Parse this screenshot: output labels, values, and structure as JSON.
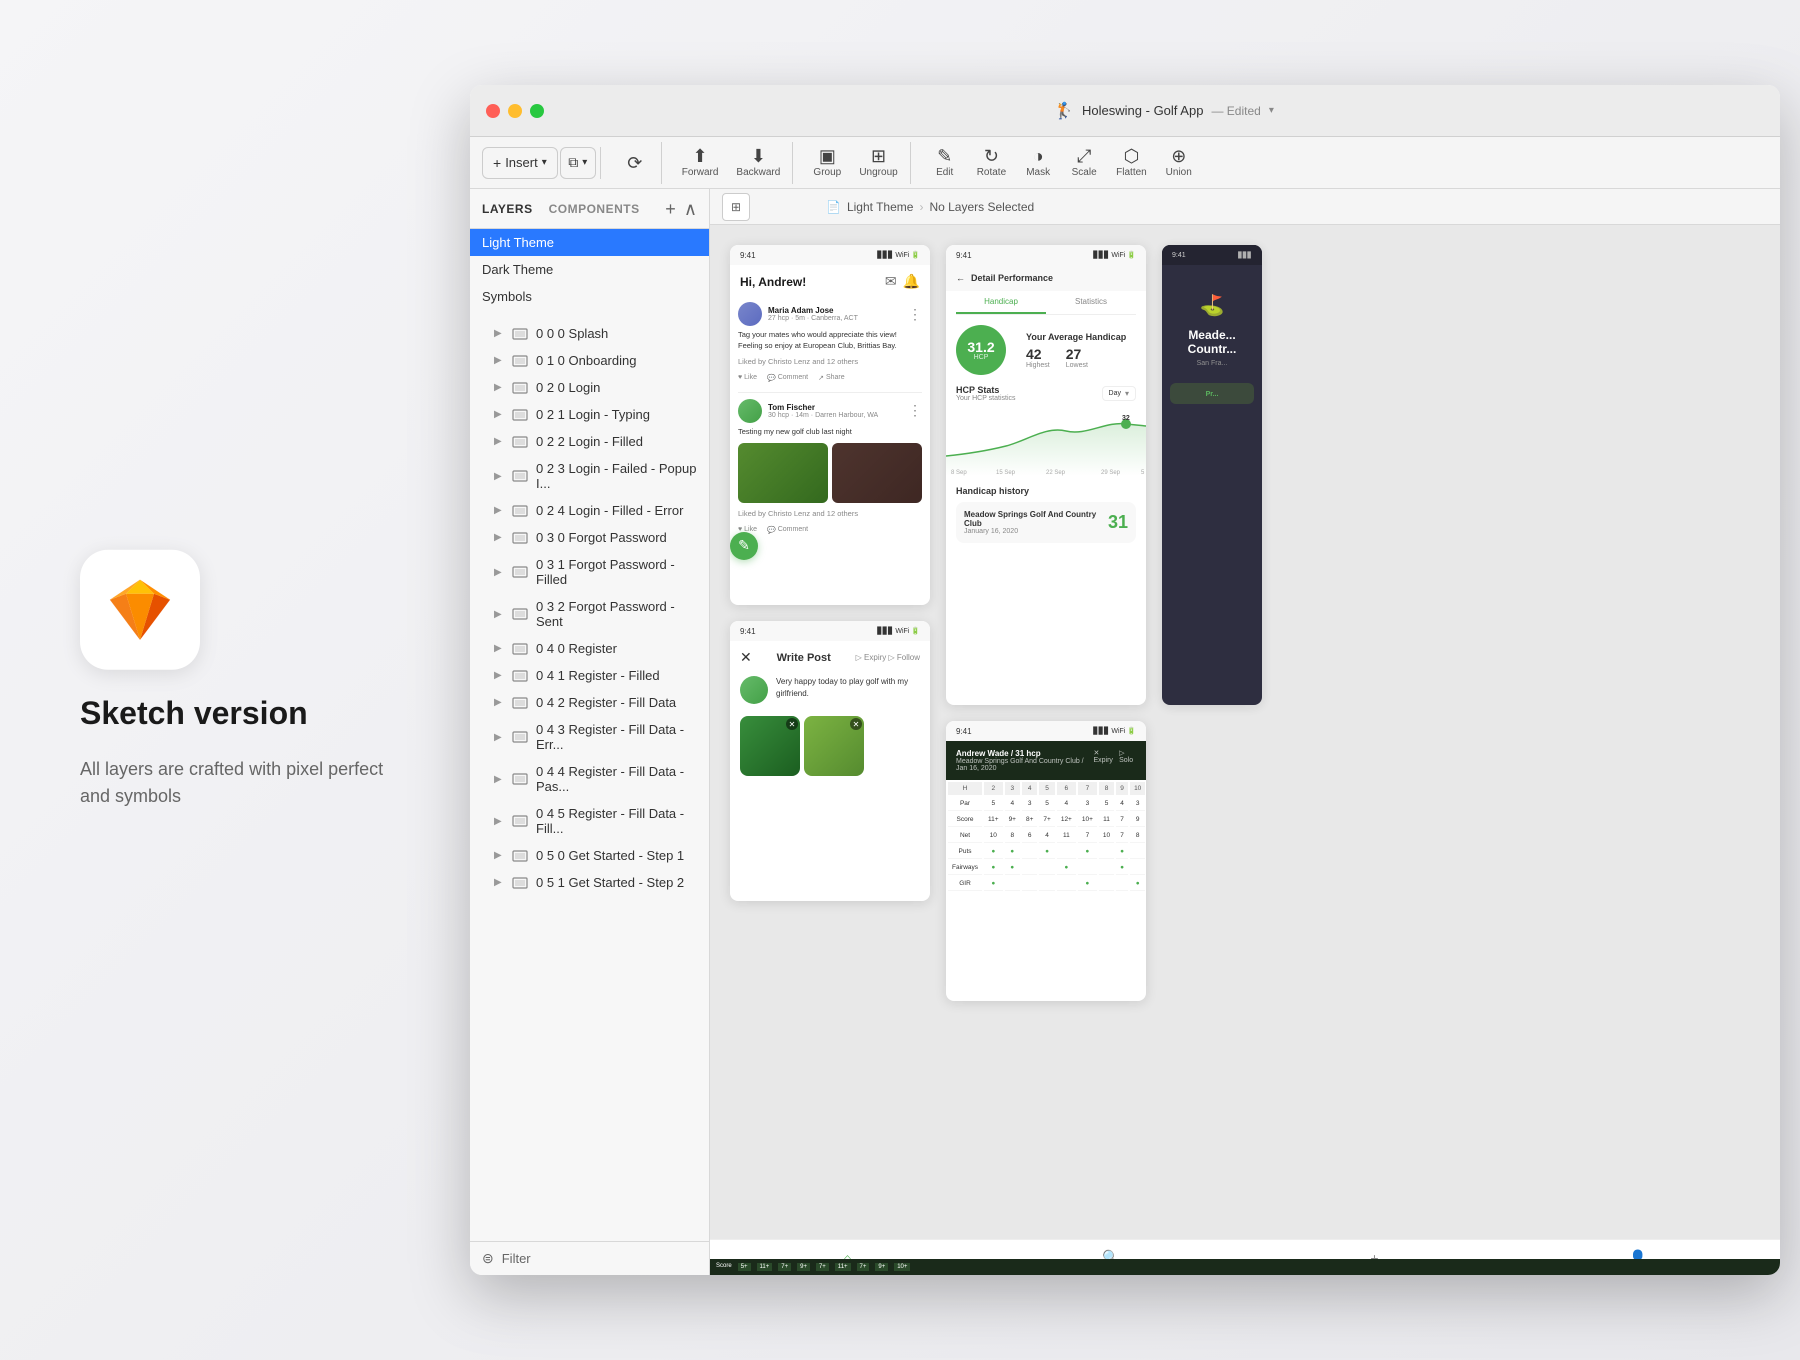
{
  "app": {
    "title": "Holeswing - Golf App",
    "edited": "Edited",
    "logo_icon": "🏌️"
  },
  "window": {
    "traffic_lights": [
      "red",
      "yellow",
      "green"
    ]
  },
  "toolbar": {
    "insert_label": "Insert",
    "data_label": "Data",
    "create_symbol_label": "Create Symbol",
    "forward_label": "Forward",
    "backward_label": "Backward",
    "group_label": "Group",
    "ungroup_label": "Ungroup",
    "edit_label": "Edit",
    "rotate_label": "Rotate",
    "mask_label": "Mask",
    "scale_label": "Scale",
    "flatten_label": "Flatten",
    "union_label": "Union"
  },
  "sidebar": {
    "tabs": [
      {
        "id": "layers",
        "label": "LAYERS"
      },
      {
        "id": "components",
        "label": "COMPONENTS"
      }
    ],
    "pages": [
      {
        "id": "light-theme",
        "label": "Light Theme",
        "active": true
      },
      {
        "id": "dark-theme",
        "label": "Dark Theme"
      },
      {
        "id": "symbols",
        "label": "Symbols"
      }
    ],
    "layers": [
      {
        "id": "000",
        "label": "0 0 0 Splash"
      },
      {
        "id": "010",
        "label": "0 1 0 Onboarding"
      },
      {
        "id": "020",
        "label": "0 2 0 Login"
      },
      {
        "id": "021",
        "label": "0 2 1 Login - Typing"
      },
      {
        "id": "022",
        "label": "0 2 2 Login - Filled"
      },
      {
        "id": "023",
        "label": "0 2 3 Login - Failed - Popup I..."
      },
      {
        "id": "024",
        "label": "0 2 4 Login - Filled - Error"
      },
      {
        "id": "030",
        "label": "0 3 0 Forgot Password"
      },
      {
        "id": "031",
        "label": "0 3 1 Forgot Password - Filled"
      },
      {
        "id": "032",
        "label": "0 3 2 Forgot Password - Sent"
      },
      {
        "id": "040",
        "label": "0 4 0 Register"
      },
      {
        "id": "041",
        "label": "0 4 1 Register - Filled"
      },
      {
        "id": "042",
        "label": "0 4 2 Register - Fill Data"
      },
      {
        "id": "043",
        "label": "0 4 3 Register - Fill Data - Err..."
      },
      {
        "id": "044",
        "label": "0 4 4 Register - Fill Data - Pas..."
      },
      {
        "id": "045",
        "label": "0 4 5 Register - Fill Data - Fill..."
      },
      {
        "id": "050",
        "label": "0 5 0 Get Started - Step 1"
      },
      {
        "id": "051",
        "label": "0 5 1 Get Started - Step 2"
      }
    ],
    "filter_label": "Filter"
  },
  "canvas": {
    "breadcrumb": {
      "page_icon": "📄",
      "page_name": "Light Theme",
      "separator": "›",
      "selection": "No Layers Selected"
    },
    "zoom_level": ""
  },
  "left_panel": {
    "title": "Sketch version",
    "description": "All layers are crafted with pixel perfect and symbols"
  },
  "mockups": {
    "feed": {
      "time": "9:41",
      "greeting": "Hi, Andrew!",
      "posts": [
        {
          "user": "Maria Adam Jose",
          "meta": "27 hcp · 5m · Canberra, ACT",
          "text": "Tag your mates who would appreciate this view! Feeling so enjoy at European Club, Brittias Bay.",
          "liked_by": "Liked by Christo Lenz and 12 others"
        },
        {
          "user": "Tom Fischer",
          "meta": "30 hcp · 14m · Darren Harbour, WA",
          "text": "Testing my new golf club last night"
        }
      ]
    },
    "performance": {
      "time": "9:41",
      "title": "Detail Performance",
      "tabs": [
        "Handicap",
        "Statistics"
      ],
      "handicap": "31.2",
      "hcp_label": "HCP",
      "avg_title": "Your Average Handicap",
      "highest": "42",
      "lowest": "27",
      "hcp_stats_label": "HCP Stats",
      "hcp_stats_sub": "Your HCP statistics"
    },
    "write_post": {
      "time": "9:41",
      "title": "Write Post",
      "text": "Very happy today to play golf with my girlfriend."
    },
    "scorecard": {
      "time": "9:41",
      "user": "Andrew Wade / 31 hcp",
      "club": "Meadow Springs Golf And Country Club / Jan 16, 2020"
    }
  }
}
